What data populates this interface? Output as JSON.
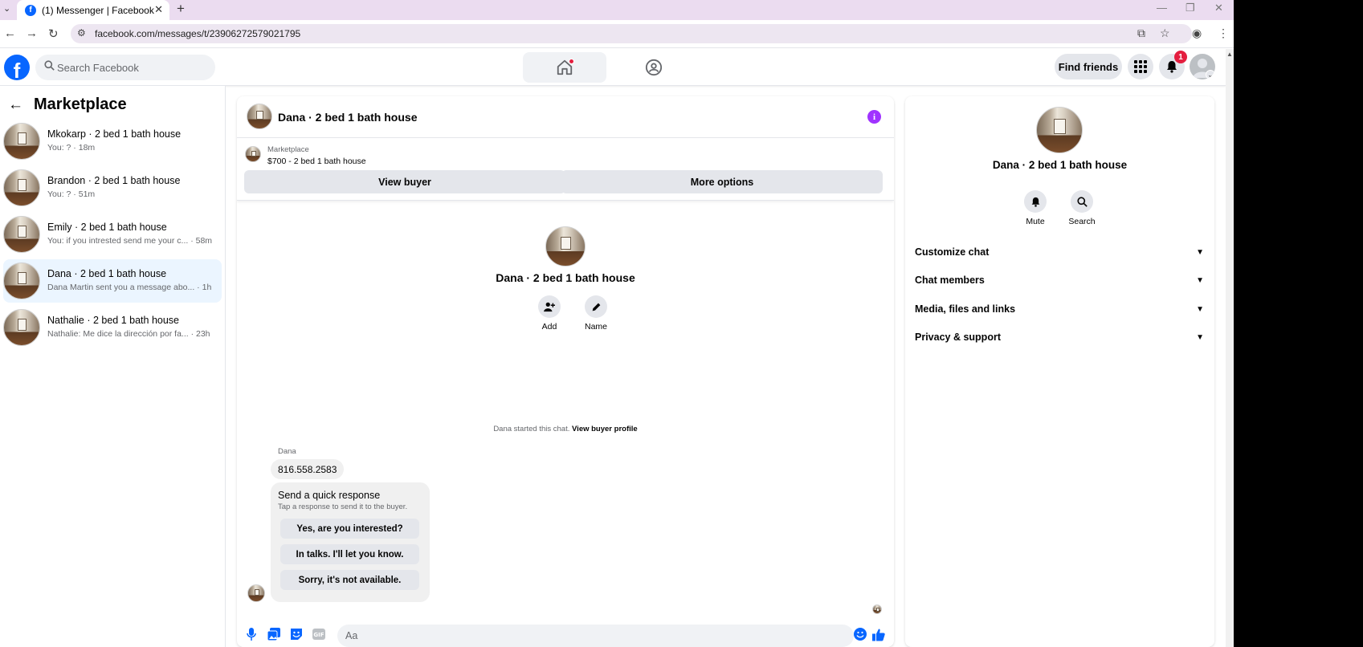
{
  "browser": {
    "tab_title": "(1) Messenger | Facebook",
    "url": "facebook.com/messages/t/23906272579021795"
  },
  "header": {
    "search_placeholder": "Search Facebook",
    "find_friends": "Find friends",
    "notification_count": "1",
    "brand_color": "#0866ff"
  },
  "sidebar": {
    "title": "Marketplace",
    "conversations": [
      {
        "name": "Mkokarp · 2 bed 1 bath house",
        "preview": "You: ? · 18m",
        "active": false
      },
      {
        "name": "Brandon · 2 bed 1 bath house",
        "preview": "You: ? · 51m",
        "active": false
      },
      {
        "name": "Emily · 2 bed 1 bath house",
        "preview": "You: if you intrested send me your c... · 58m",
        "active": false
      },
      {
        "name": "Dana · 2 bed 1 bath house",
        "preview": "Dana Martin sent you a message abo... · 1h",
        "active": true
      },
      {
        "name": "Nathalie · 2 bed 1 bath house",
        "preview": "Nathalie: Me dice la dirección por fa... · 23h",
        "active": false
      }
    ]
  },
  "chat": {
    "title": "Dana · 2 bed 1 bath house",
    "marketplace_label": "Marketplace",
    "listing": "$700 - 2 bed 1 bath house",
    "view_buyer": "View buyer",
    "more_options": "More options",
    "intro_name": "Dana · 2 bed 1 bath house",
    "add_label": "Add",
    "name_label": "Name",
    "started_text": "Dana started this chat.",
    "view_buyer_profile": "View buyer profile",
    "sender": "Dana",
    "message": "816.558.2583",
    "quick_title": "Send a quick response",
    "quick_subtitle": "Tap a response to send it to the buyer.",
    "quick_responses": [
      "Yes, are you interested?",
      "In talks. I'll let you know.",
      "Sorry, it's not available."
    ],
    "input_placeholder": "Aa"
  },
  "info_panel": {
    "name": "Dana · 2 bed 1 bath house",
    "mute": "Mute",
    "search": "Search",
    "sections": [
      "Customize chat",
      "Chat members",
      "Media, files and links",
      "Privacy & support"
    ]
  }
}
